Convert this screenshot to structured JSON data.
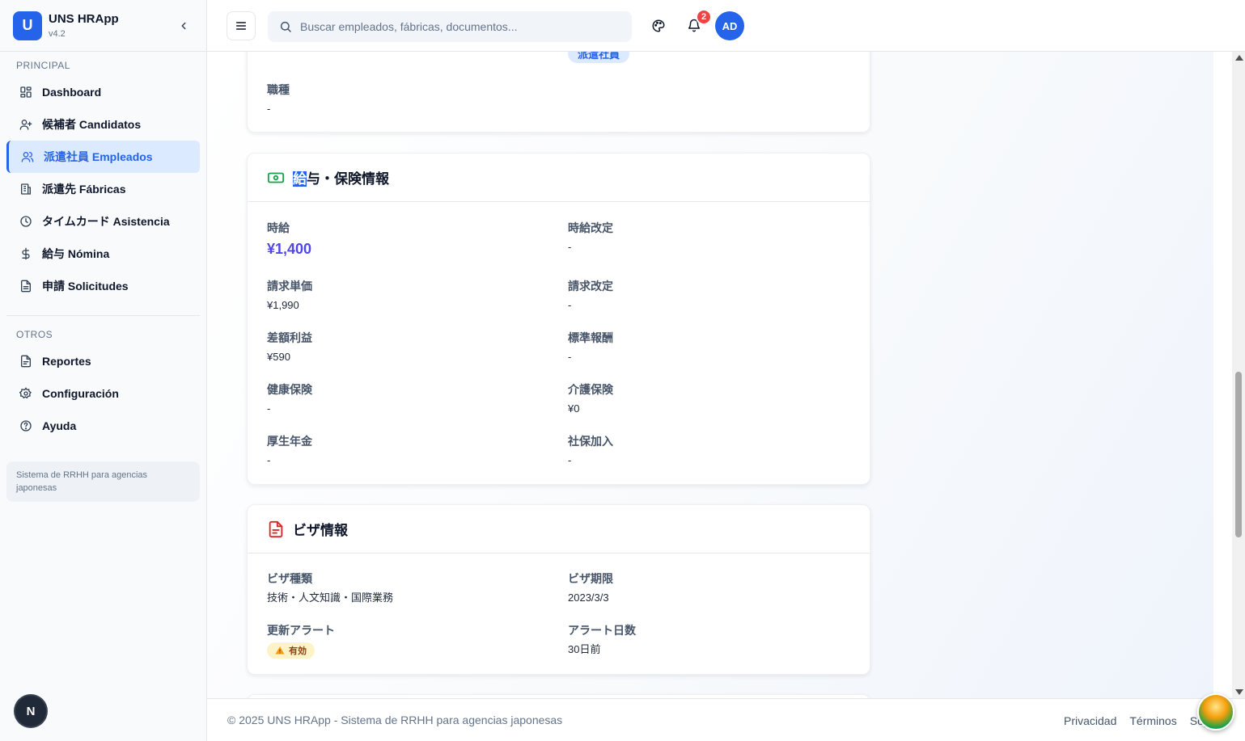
{
  "app": {
    "logo_letter": "U",
    "name": "UNS HRApp",
    "version": "v4.2"
  },
  "sidebar": {
    "section_principal": "PRINCIPAL",
    "items": [
      {
        "label": "Dashboard",
        "icon": "dashboard-icon"
      },
      {
        "label": "候補者 Candidatos",
        "icon": "user-plus-icon"
      },
      {
        "label": "派遣社員 Empleados",
        "icon": "users-icon",
        "active": true
      },
      {
        "label": "派遣先 Fábricas",
        "icon": "building-icon"
      },
      {
        "label": "タイムカード Asistencia",
        "icon": "clock-icon"
      },
      {
        "label": "給与 Nómina",
        "icon": "dollar-icon"
      },
      {
        "label": "申請 Solicitudes",
        "icon": "file-icon"
      }
    ],
    "section_otros": "OTROS",
    "other_items": [
      {
        "label": "Reportes",
        "icon": "report-icon"
      },
      {
        "label": "Configuración",
        "icon": "gear-icon"
      },
      {
        "label": "Ayuda",
        "icon": "help-icon"
      }
    ],
    "note": "Sistema de RRHH para agencias japonesas",
    "n_badge": "N"
  },
  "header": {
    "search_placeholder": "Buscar empleados, fábricas, documentos...",
    "notification_count": "2",
    "avatar_initials": "AD"
  },
  "job_card": {
    "top_pill": "派遣社員",
    "job_type_label": "職種",
    "job_type_value": "-"
  },
  "salary_card": {
    "title_highlight": "給",
    "title_rest": "与・保険情報",
    "fields": {
      "hourly_label": "時給",
      "hourly_value": "¥1,400",
      "hourly_revision_label": "時給改定",
      "hourly_revision_value": "-",
      "billing_unit_label": "請求単価",
      "billing_unit_value": "¥1,990",
      "billing_revision_label": "請求改定",
      "billing_revision_value": "-",
      "margin_label": "差額利益",
      "margin_value": "¥590",
      "standard_comp_label": "標準報酬",
      "standard_comp_value": "-",
      "health_ins_label": "健康保険",
      "health_ins_value": "-",
      "care_ins_label": "介護保険",
      "care_ins_value": "¥0",
      "pension_label": "厚生年金",
      "pension_value": "-",
      "social_ins_label": "社保加入",
      "social_ins_value": "-"
    }
  },
  "visa_card": {
    "title": "ビザ情報",
    "fields": {
      "visa_type_label": "ビザ種類",
      "visa_type_value": "技術・人文知識・国際業務",
      "visa_expiry_label": "ビザ期限",
      "visa_expiry_value": "2023/3/3",
      "renewal_alert_label": "更新アラート",
      "renewal_alert_value": "有効",
      "alert_days_label": "アラート日数",
      "alert_days_value": "30日前"
    }
  },
  "footer": {
    "copyright": "© 2025 UNS HRApp - Sistema de RRHH para agencias japonesas",
    "links": [
      "Privacidad",
      "Términos",
      "Soporte"
    ]
  },
  "colors": {
    "accent": "#2563eb",
    "salary_value": "#4f46e5",
    "badge_red": "#ef4444",
    "warn_bg": "#fef3c7"
  }
}
